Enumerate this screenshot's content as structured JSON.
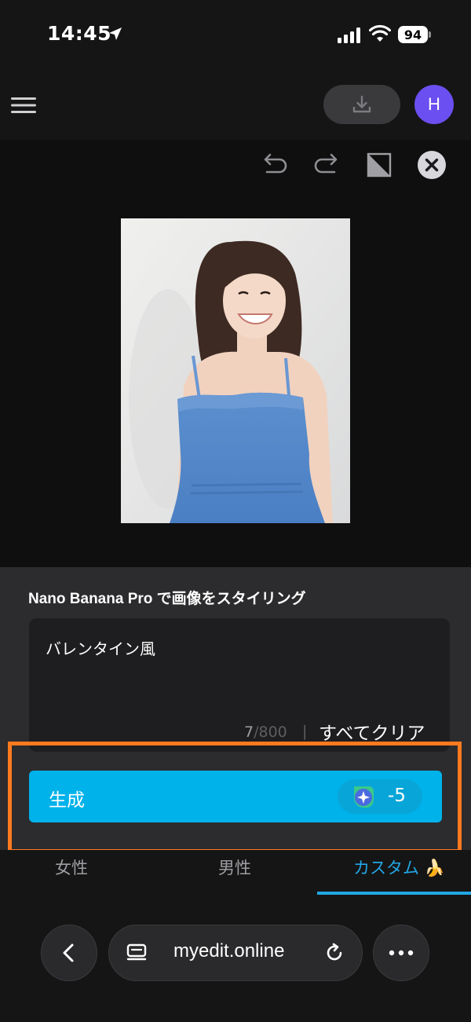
{
  "status": {
    "time": "14:45",
    "battery": "94",
    "icons": [
      "location-arrow-icon",
      "signal-icon",
      "wifi-icon",
      "battery-icon"
    ]
  },
  "header": {
    "menu_icon": "hamburger-menu-icon",
    "download_icon": "download-icon",
    "avatar_letter": "H",
    "avatar_color": "#6c4ff0"
  },
  "toolbar": {
    "icons": [
      "undo-icon",
      "redo-icon",
      "compare-icon",
      "close-icon"
    ]
  },
  "panel": {
    "title": "Nano Banana Pro で画像をスタイリング",
    "prompt": "バレンタイン風",
    "char_count": "7",
    "char_max": "/800",
    "separator": "|",
    "clear_all": "すべてクリア"
  },
  "generate": {
    "label": "生成",
    "cost": "-5",
    "cost_icon": "credit-sparkle-icon",
    "color": "#00b2ea",
    "highlight_color": "#ff7a1f"
  },
  "tabs": [
    {
      "label": "女性",
      "active": false
    },
    {
      "label": "男性",
      "active": false
    },
    {
      "label": "カスタム",
      "active": true,
      "emoji": "🍌"
    }
  ],
  "browser": {
    "url": "myedit.online",
    "icons": [
      "back-chevron-icon",
      "page-menu-icon",
      "reload-icon",
      "more-icon"
    ]
  }
}
